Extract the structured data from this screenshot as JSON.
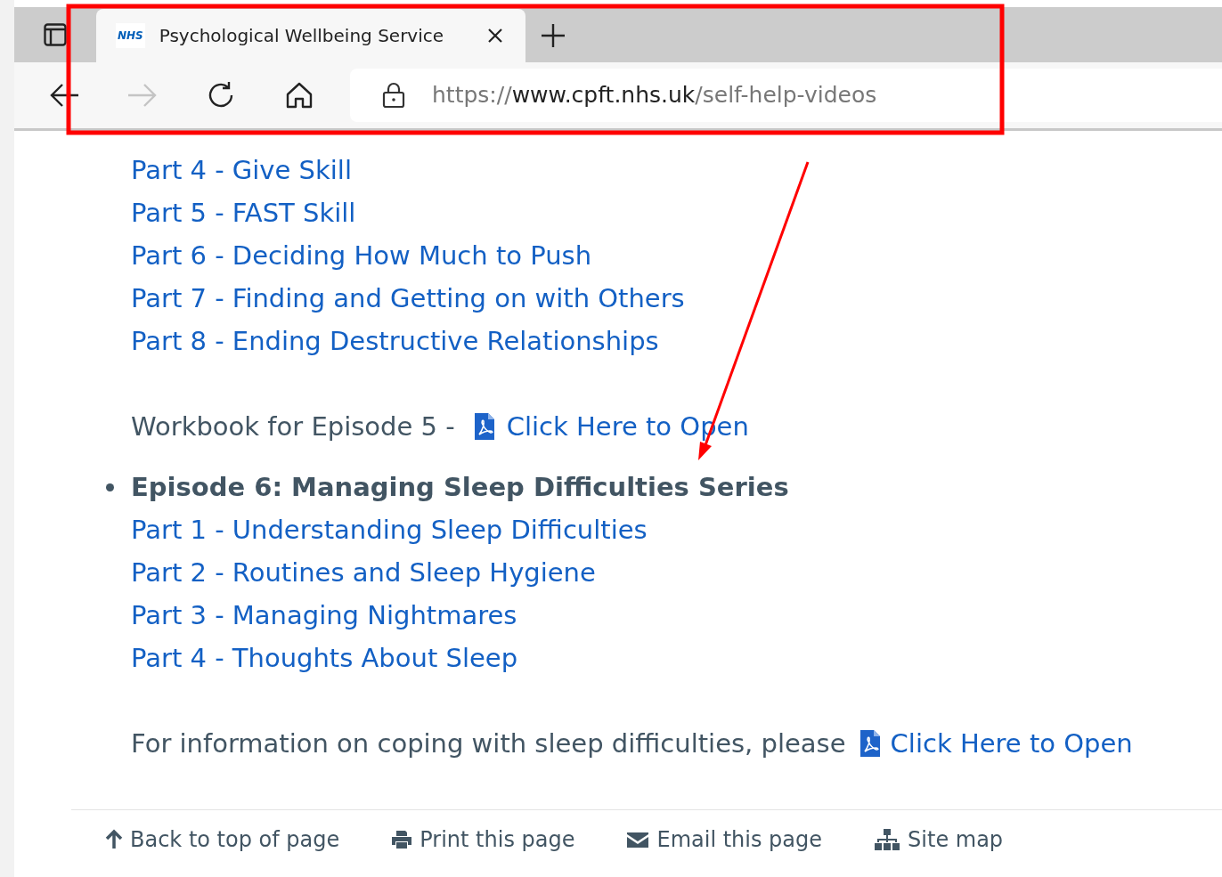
{
  "browser": {
    "tab": {
      "logo": "NHS",
      "title": "Psychological Wellbeing Service",
      "selected": true
    },
    "address": {
      "scheme": "https://",
      "host": "www.cpft.nhs.uk",
      "path": "/self-help-videos"
    },
    "forward_disabled": true
  },
  "episode_5": {
    "parts": [
      "Part 4 - Give Skill",
      "Part 5 - FAST Skill",
      "Part 6 - Deciding How Much to Push",
      "Part 7 - Finding and Getting on with Others",
      "Part 8 - Ending Destructive Relationships"
    ],
    "workbook": {
      "text": "Workbook for Episode 5 -",
      "link": "Click Here to Open"
    }
  },
  "episode_6": {
    "title": "Episode 6: Managing Sleep Difficulties Series",
    "parts": [
      "Part 1 - Understanding Sleep Difficulties",
      "Part 2 - Routines and Sleep Hygiene",
      "Part 3 - Managing Nightmares",
      "Part 4 - Thoughts About Sleep"
    ],
    "info": {
      "text": "For information on coping with sleep difficulties, please",
      "link": "Click Here to Open"
    }
  },
  "footer": [
    {
      "kind": "up",
      "label": "Back to top of page"
    },
    {
      "kind": "print",
      "label": "Print this page"
    },
    {
      "kind": "email",
      "label": "Email this page"
    },
    {
      "kind": "sitemap",
      "label": "Site map"
    }
  ]
}
